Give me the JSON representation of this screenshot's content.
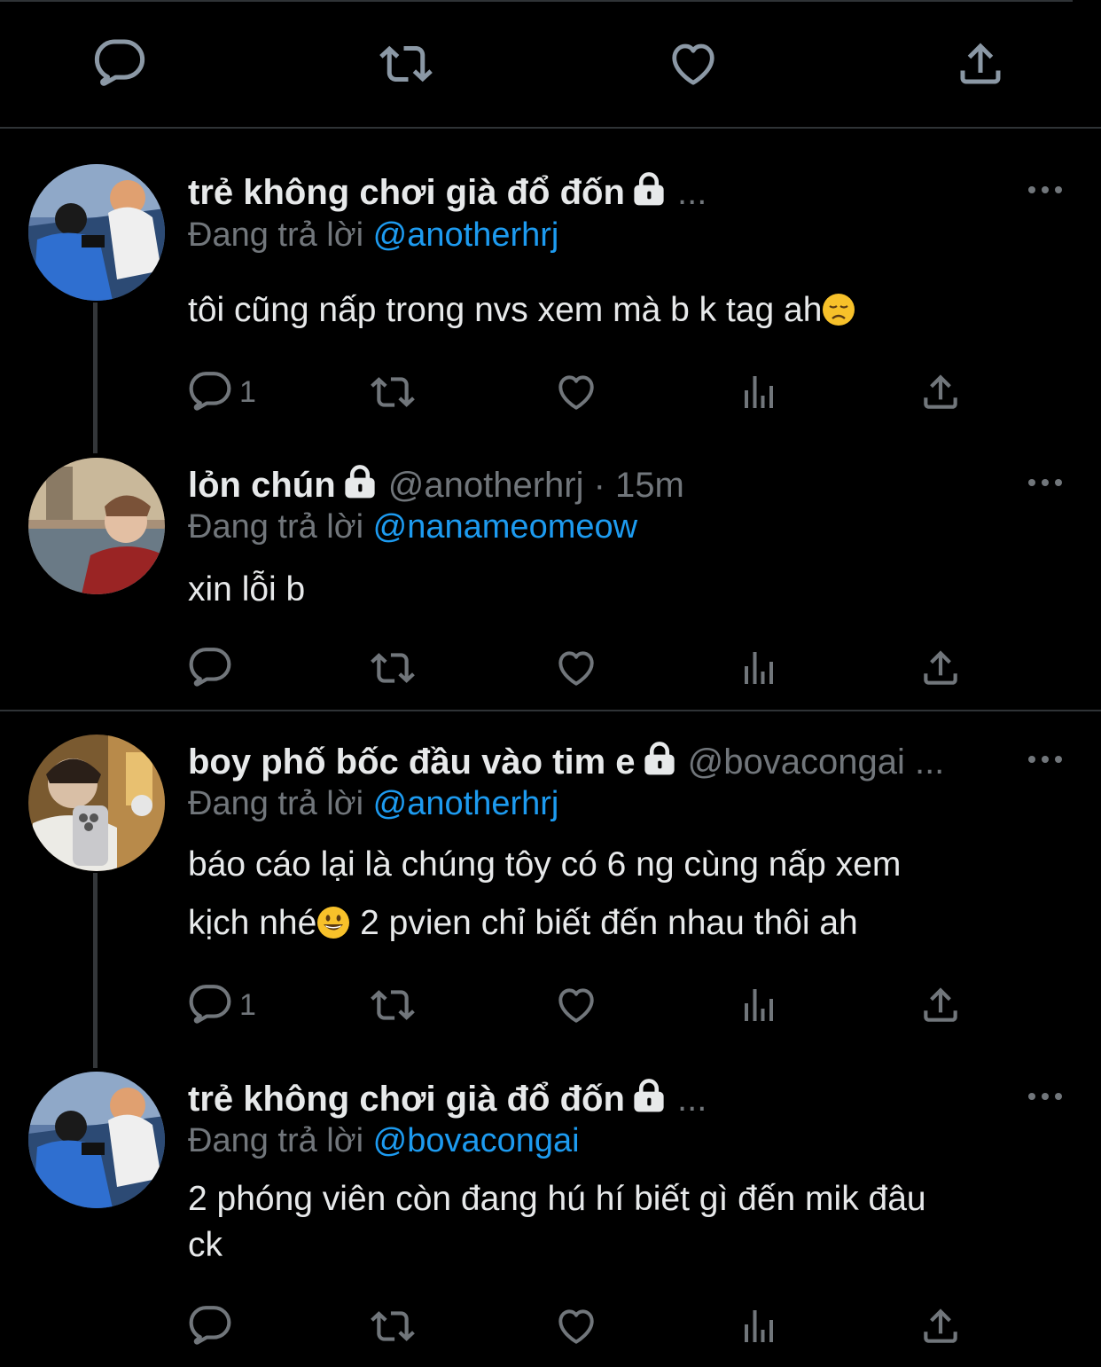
{
  "top_actions": {
    "reply": "comment-icon",
    "retweet": "retweet-icon",
    "like": "heart-icon",
    "share": "share-icon"
  },
  "reply_prefix": "Đang trả lời",
  "tweets": [
    {
      "name": "trẻ không chơi già đổ đốn",
      "handle_meta": "...",
      "replying_to": "@anotherhrj",
      "text": "tôi cũng nấp trong nvs xem mà b k tag ah",
      "emoji": "disappointed-face",
      "reply_count": "1",
      "more": "•••"
    },
    {
      "name": "lỏn chún",
      "handle_meta": "@anotherhrj · 15m",
      "replying_to": "@nanameomeow",
      "text": "xin lỗi b",
      "reply_count": "",
      "more": "•••"
    },
    {
      "name": "boy phố bốc đầu vào tim e",
      "handle_meta": "@bovacongai ...",
      "replying_to": "@anotherhrj",
      "text_line1": "báo cáo lại là chúng tôy có 6 ng cùng nấp xem",
      "text_line2_a": "kịch nhé",
      "emoji": "grinning-face",
      "text_line2_b": " 2 pvien chỉ biết đến nhau thôi ah",
      "reply_count": "1",
      "more": "•••"
    },
    {
      "name": "trẻ không chơi già đổ đốn",
      "handle_meta": "...",
      "replying_to": "@bovacongai",
      "text_line1": "2 phóng viên còn đang hú hí biết gì đến mik đâu",
      "text_line2": "ck",
      "reply_count": "",
      "more": "•••"
    }
  ],
  "colors": {
    "background": "#000000",
    "text": "#e7e9ea",
    "muted": "#71767b",
    "link": "#1d9bf0",
    "divider": "#2f3336"
  }
}
